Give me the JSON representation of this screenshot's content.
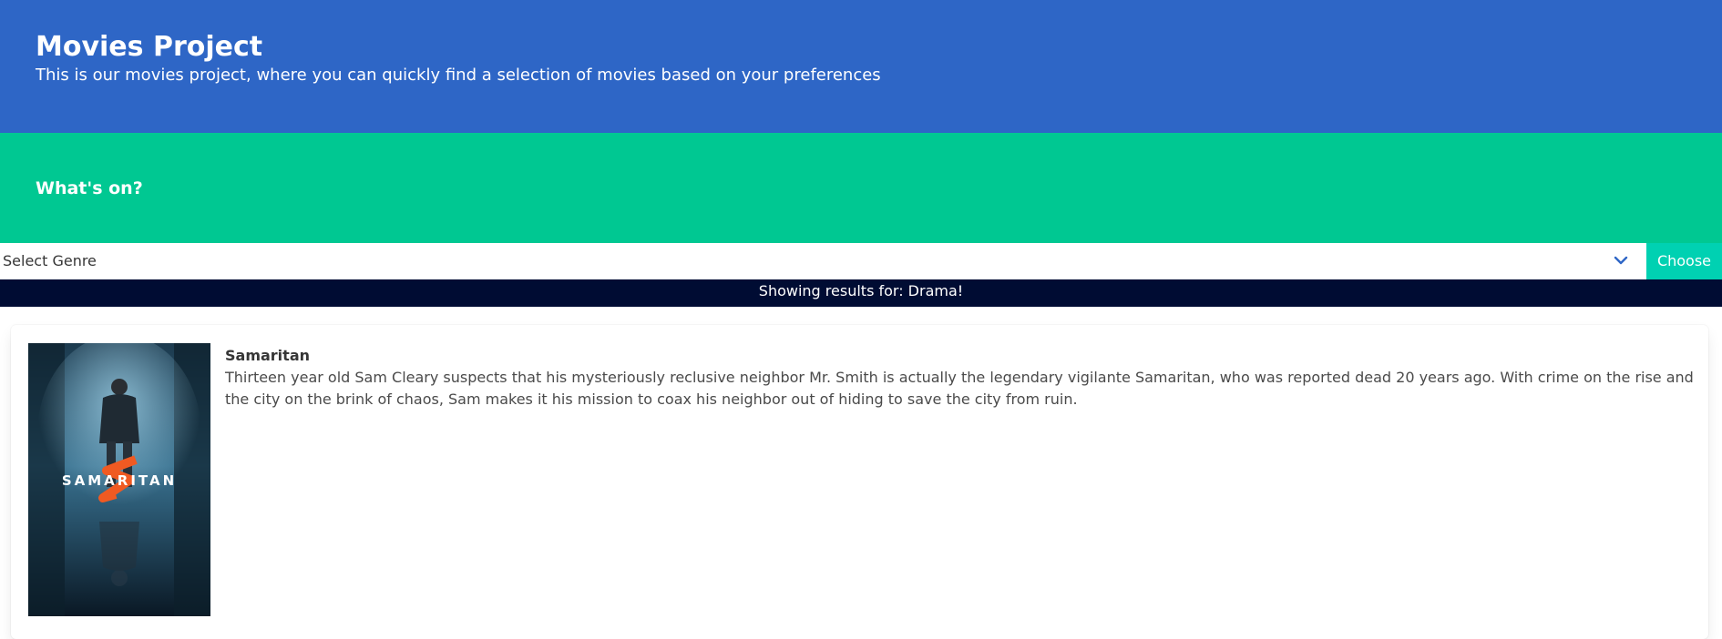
{
  "header": {
    "title": "Movies Project",
    "subtitle": "This is our movies project, where you can quickly find a selection of movies based on your preferences",
    "background": "#2e66c6"
  },
  "section": {
    "title": "What's on?",
    "background": "#00c892"
  },
  "genre_filter": {
    "selected": "Select Genre",
    "button_label": "Choose",
    "button_color": "#00d1b2",
    "chevron_icon": "chevron-down-icon"
  },
  "results": {
    "label": "Showing results for: Drama!",
    "background": "#000c33"
  },
  "movies": [
    {
      "title": "Samaritan",
      "overview": "Thirteen year old Sam Cleary suspects that his mysteriously reclusive neighbor Mr. Smith is actually the legendary vigilante Samaritan, who was reported dead 20 years ago. With crime on the rise and the city on the brink of chaos, Sam makes it his mission to coax his neighbor out of hiding to save the city from ruin.",
      "poster_text": "SAMARITAN"
    }
  ]
}
